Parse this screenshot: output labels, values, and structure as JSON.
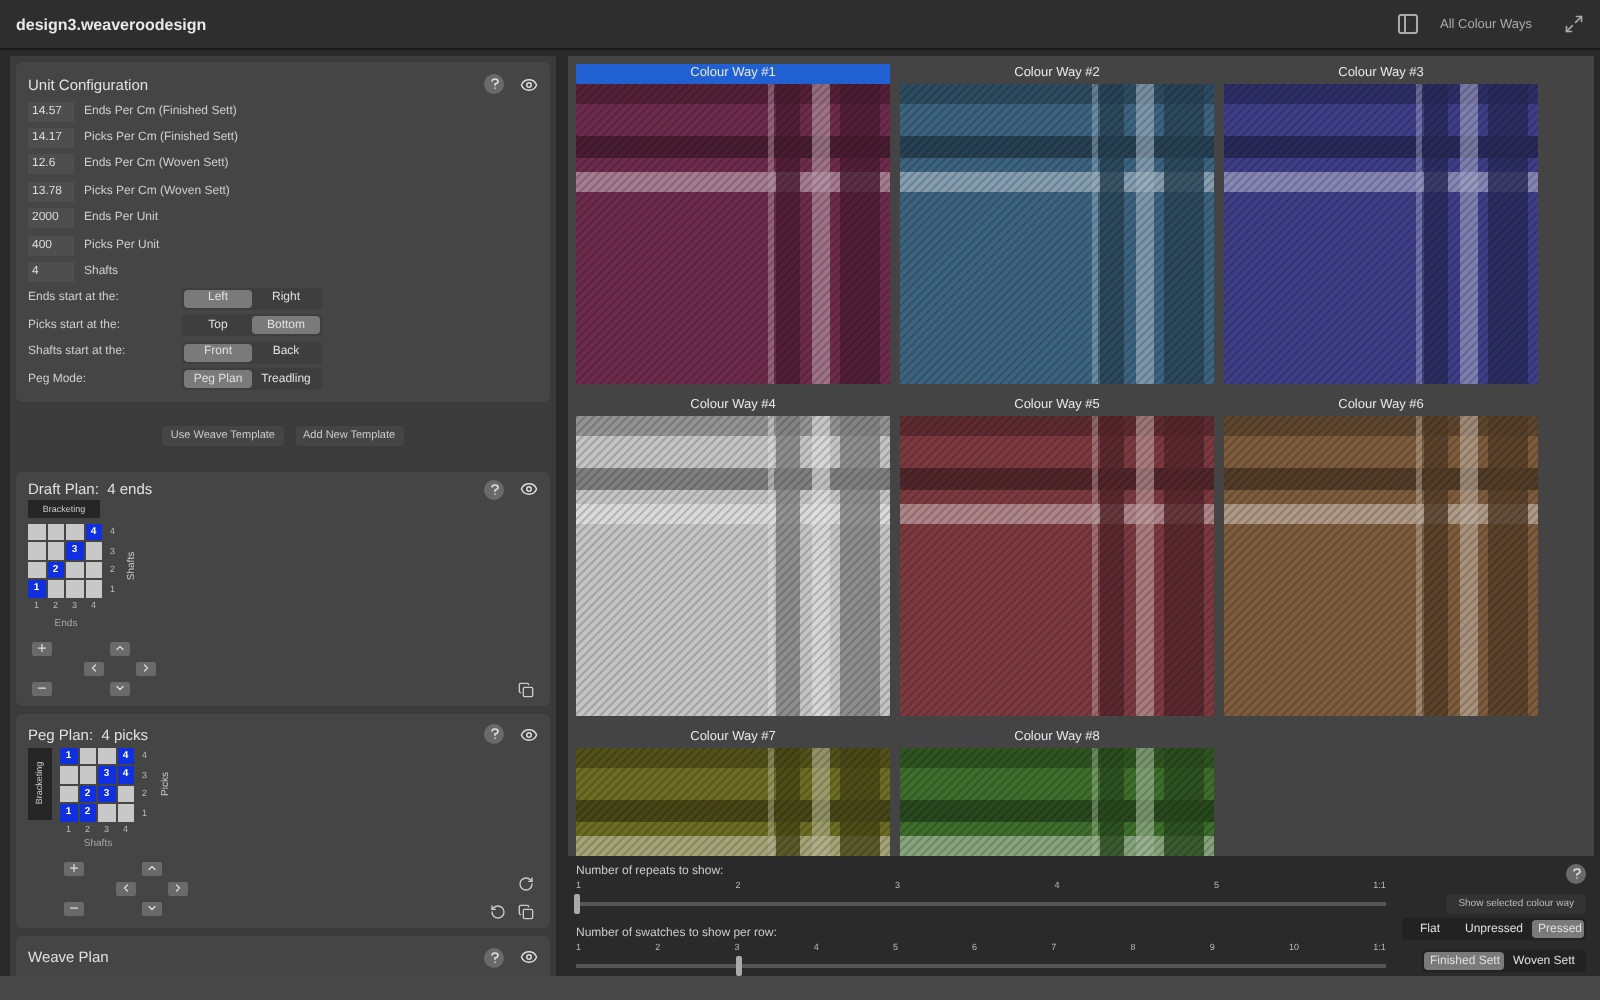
{
  "window": {
    "title": "design3.weaveroodesign",
    "view_label": "All Colour Ways"
  },
  "unit_configuration": {
    "title": "Unit Configuration",
    "fields": [
      {
        "value": "14.57",
        "label": "Ends Per Cm (Finished Sett)"
      },
      {
        "value": "14.17",
        "label": "Picks Per Cm (Finished Sett)"
      },
      {
        "value": "12.6",
        "label": "Ends Per Cm (Woven Sett)"
      },
      {
        "value": "13.78",
        "label": "Picks Per Cm (Woven Sett)"
      },
      {
        "value": "2000",
        "label": "Ends Per Unit"
      },
      {
        "value": "400",
        "label": "Picks Per Unit"
      },
      {
        "value": "4",
        "label": "Shafts"
      }
    ],
    "toggles": [
      {
        "label": "Ends start at the:",
        "options": [
          {
            "label": "Left",
            "selected": true
          },
          {
            "label": "Right",
            "selected": false
          }
        ]
      },
      {
        "label": "Picks start at the:",
        "options": [
          {
            "label": "Top",
            "selected": false
          },
          {
            "label": "Bottom",
            "selected": true
          }
        ]
      },
      {
        "label": "Shafts start at the:",
        "options": [
          {
            "label": "Front",
            "selected": true
          },
          {
            "label": "Back",
            "selected": false
          }
        ]
      },
      {
        "label": "Peg Mode:",
        "options": [
          {
            "label": "Peg Plan",
            "selected": true
          },
          {
            "label": "Treadling",
            "selected": false
          }
        ]
      }
    ],
    "template_buttons": [
      "Use Weave Template",
      "Add New Template"
    ]
  },
  "draft_plan": {
    "title": "Draft Plan:  4 ends",
    "bracketing": "Bracketing",
    "row_axis": "Shafts",
    "column_axis": "Ends",
    "column_labels": [
      "1",
      "2",
      "3",
      "4"
    ],
    "rows": [
      {
        "label": "4",
        "cells": [
          {
            "on": false
          },
          {
            "on": false
          },
          {
            "on": false
          },
          {
            "on": true,
            "text": "4"
          }
        ]
      },
      {
        "label": "3",
        "cells": [
          {
            "on": false
          },
          {
            "on": false
          },
          {
            "on": true,
            "text": "3"
          },
          {
            "on": false
          }
        ]
      },
      {
        "label": "2",
        "cells": [
          {
            "on": false
          },
          {
            "on": true,
            "text": "2"
          },
          {
            "on": false
          },
          {
            "on": false
          }
        ]
      },
      {
        "label": "1",
        "cells": [
          {
            "on": true,
            "text": "1"
          },
          {
            "on": false
          },
          {
            "on": false
          },
          {
            "on": false
          }
        ]
      }
    ]
  },
  "peg_plan": {
    "title": "Peg Plan:  4 picks",
    "bracketing": "Bracketing",
    "row_axis": "Picks",
    "column_axis": "Shafts",
    "column_labels": [
      "1",
      "2",
      "3",
      "4"
    ],
    "rows": [
      {
        "label": "4",
        "cells": [
          {
            "on": true,
            "text": "1"
          },
          {
            "on": false
          },
          {
            "on": false
          },
          {
            "on": true,
            "text": "4"
          }
        ]
      },
      {
        "label": "3",
        "cells": [
          {
            "on": false
          },
          {
            "on": false
          },
          {
            "on": true,
            "text": "3"
          },
          {
            "on": true,
            "text": "4"
          }
        ]
      },
      {
        "label": "2",
        "cells": [
          {
            "on": false
          },
          {
            "on": true,
            "text": "2"
          },
          {
            "on": true,
            "text": "3"
          },
          {
            "on": false
          }
        ]
      },
      {
        "label": "1",
        "cells": [
          {
            "on": true,
            "text": "1"
          },
          {
            "on": true,
            "text": "2"
          },
          {
            "on": false
          },
          {
            "on": false
          }
        ]
      }
    ]
  },
  "weave_plan": {
    "title": "Weave Plan"
  },
  "colour_ways": [
    {
      "name": "Colour Way #1",
      "selected": true,
      "color": "#6e2c4c"
    },
    {
      "name": "Colour Way #2",
      "selected": false,
      "color": "#3c6480"
    },
    {
      "name": "Colour Way #3",
      "selected": false,
      "color": "#3e3f88"
    },
    {
      "name": "Colour Way #4",
      "selected": false,
      "color": "#c4c4c4"
    },
    {
      "name": "Colour Way #5",
      "selected": false,
      "color": "#7c3a40"
    },
    {
      "name": "Colour Way #6",
      "selected": false,
      "color": "#7c5c3c"
    },
    {
      "name": "Colour Way #7",
      "selected": false,
      "color": "#6c6c22"
    },
    {
      "name": "Colour Way #8",
      "selected": false,
      "color": "#3e6e2c"
    }
  ],
  "sliders": [
    {
      "label": "Number of repeats to show:",
      "ticks": [
        "1",
        "2",
        "3",
        "4",
        "5",
        "1:1"
      ],
      "level": 0
    },
    {
      "label": "Number of swatches to show per row:",
      "ticks": [
        "1",
        "2",
        "3",
        "4",
        "5",
        "6",
        "7",
        "8",
        "9",
        "10",
        "1:1"
      ],
      "level": 0.2
    }
  ],
  "show_selected_button": "Show selected colour way",
  "press_modes": [
    {
      "label": "Flat",
      "selected": false
    },
    {
      "label": "Unpressed",
      "selected": false
    },
    {
      "label": "Pressed",
      "selected": true
    }
  ],
  "sett_modes": [
    {
      "label": "Finished Sett",
      "selected": true
    },
    {
      "label": "Woven Sett",
      "selected": false
    }
  ]
}
